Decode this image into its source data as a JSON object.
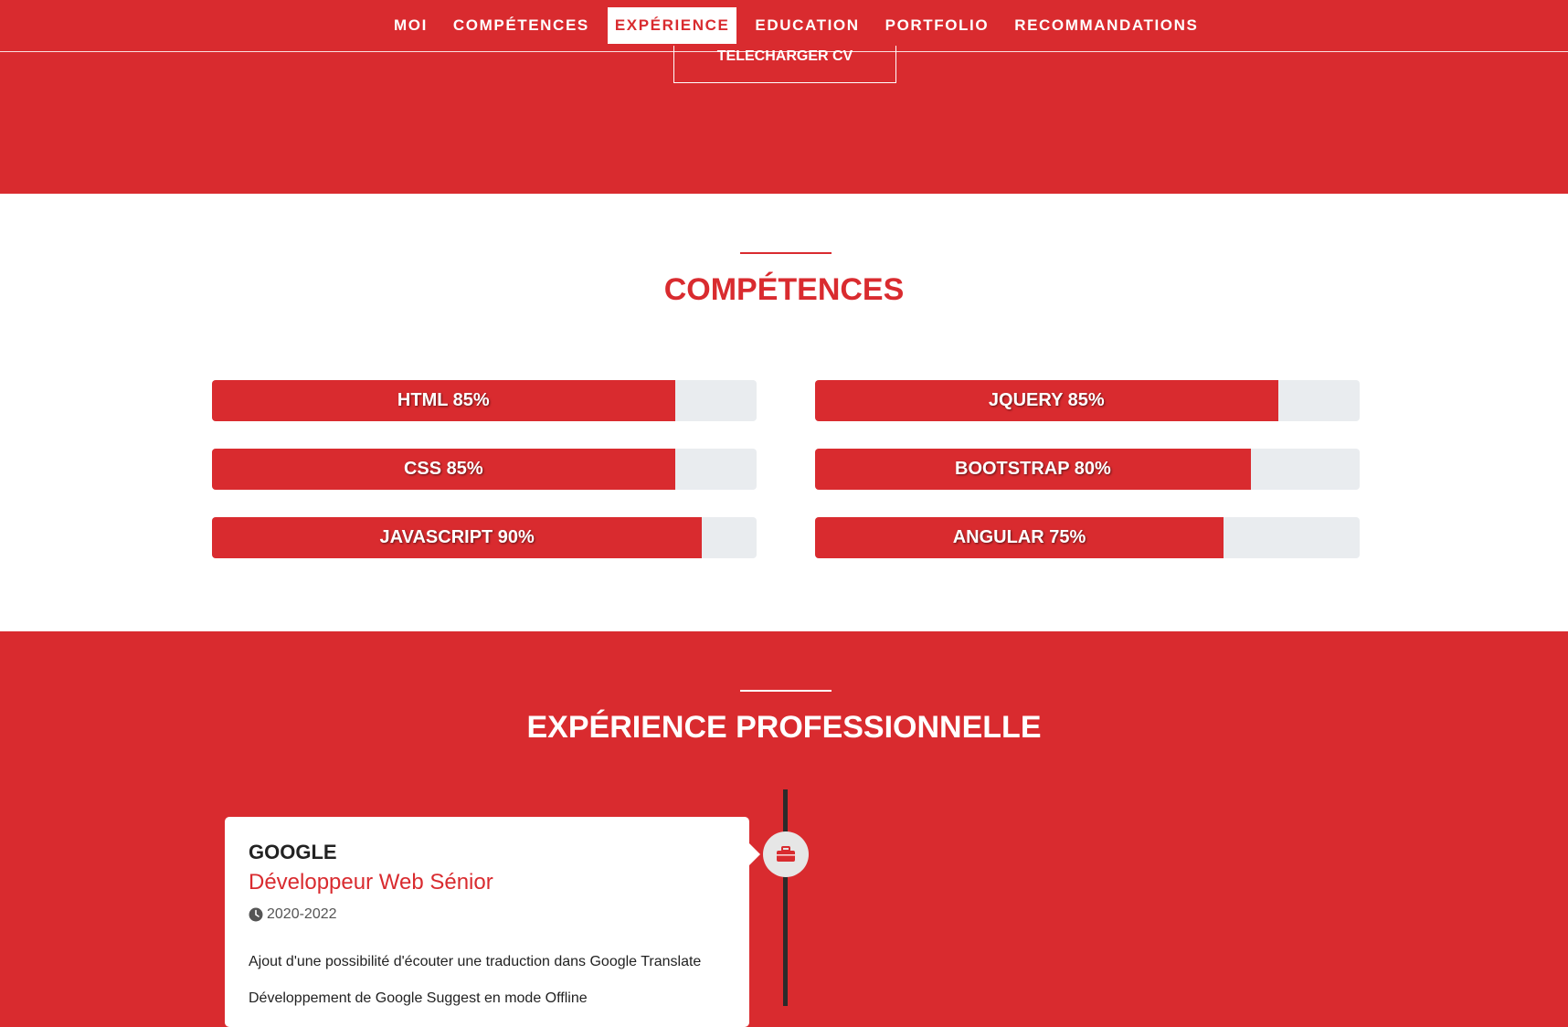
{
  "nav": {
    "items": [
      {
        "label": "MOI"
      },
      {
        "label": "COMPÉTENCES"
      },
      {
        "label": "EXPÉRIENCE",
        "active": true
      },
      {
        "label": "EDUCATION"
      },
      {
        "label": "PORTFOLIO"
      },
      {
        "label": "RECOMMANDATIONS"
      }
    ]
  },
  "hero": {
    "cv_button": "TELECHARGER CV"
  },
  "skills": {
    "title": "COMPÉTENCES",
    "items": [
      {
        "label": "HTML 85%",
        "percent": 85
      },
      {
        "label": "JQUERY 85%",
        "percent": 85
      },
      {
        "label": "CSS 85%",
        "percent": 85
      },
      {
        "label": "BOOTSTRAP 80%",
        "percent": 80
      },
      {
        "label": "JAVASCRIPT 90%",
        "percent": 90
      },
      {
        "label": "ANGULAR 75%",
        "percent": 75
      }
    ]
  },
  "experience": {
    "title": "EXPÉRIENCE PROFESSIONNELLE",
    "icon": "briefcase-icon",
    "jobs": [
      {
        "company": "GOOGLE",
        "role": "Développeur Web Sénior",
        "dates": "2020-2022",
        "lines": [
          "Ajout d'une possibilité d'écouter une traduction dans Google Translate",
          "Développement de Google Suggest en mode Offline"
        ]
      }
    ]
  },
  "colors": {
    "brand": "#d92b2f",
    "bar_track": "#e9ecef",
    "timeline": "#2b2b2b"
  }
}
